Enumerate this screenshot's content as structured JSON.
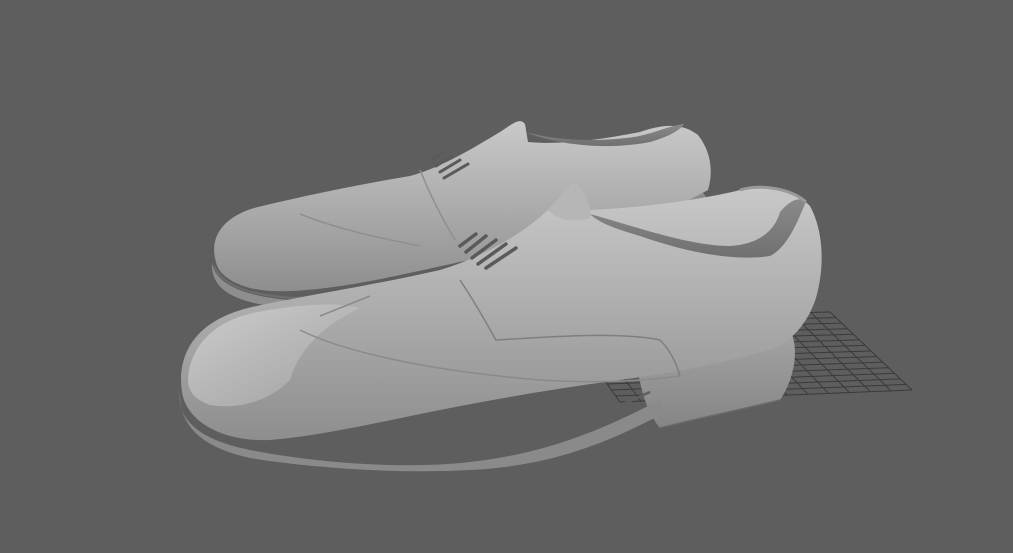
{
  "viewport": {
    "background_color": "#5e5e5e",
    "grid_color": "#3a3a3a",
    "model_color": "#a8a8a8",
    "lace_color": "#5a5a5a",
    "content": [
      "left-shoe",
      "right-shoe",
      "ground-grid"
    ]
  }
}
